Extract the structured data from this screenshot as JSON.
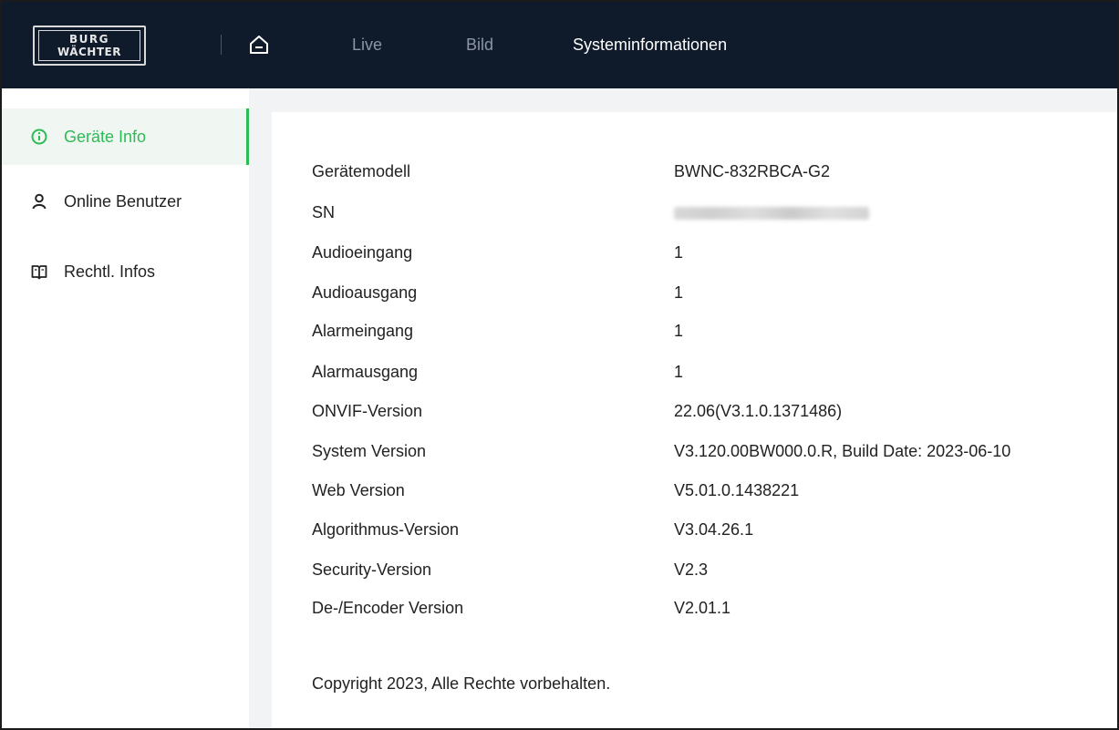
{
  "header": {
    "logo_line1": "BURG",
    "logo_line2": "WÄCHTER",
    "nav": [
      {
        "label": "Live"
      },
      {
        "label": "Bild"
      },
      {
        "label": "Systeminformationen"
      }
    ],
    "active_nav": "Systeminformationen",
    "home_icon": "home-icon"
  },
  "sidebar": {
    "items": [
      {
        "label": "Geräte Info",
        "icon": "info-circle-icon",
        "active": true
      },
      {
        "label": "Online Benutzer",
        "icon": "user-icon",
        "active": false
      },
      {
        "label": "Rechtl. Infos",
        "icon": "book-icon",
        "active": false
      }
    ]
  },
  "device_info": {
    "rows": [
      {
        "label": "Gerätemodell",
        "value": "BWNC-832RBCA-G2"
      },
      {
        "label": "SN",
        "value": ""
      },
      {
        "label": "Audioeingang",
        "value": "1"
      },
      {
        "label": "Audioausgang",
        "value": "1"
      },
      {
        "label": "Alarmeingang",
        "value": "1"
      },
      {
        "label": "Alarmausgang",
        "value": "1"
      },
      {
        "label": "ONVIF-Version",
        "value": "22.06(V3.1.0.1371486)"
      },
      {
        "label": "System Version",
        "value": "V3.120.00BW000.0.R, Build Date: 2023-06-10"
      },
      {
        "label": "Web Version",
        "value": "V5.01.0.1438221"
      },
      {
        "label": "Algorithmus-Version",
        "value": "V3.04.26.1"
      },
      {
        "label": "Security-Version",
        "value": "V2.3"
      },
      {
        "label": "De-/Encoder Version",
        "value": "V2.01.1"
      }
    ],
    "copyright": "Copyright 2023, Alle Rechte vorbehalten."
  },
  "colors": {
    "topbar": "#0f1a2b",
    "accent": "#2dbb56",
    "nav_inactive": "#8c95a3",
    "main_bg": "#f2f3f5"
  }
}
